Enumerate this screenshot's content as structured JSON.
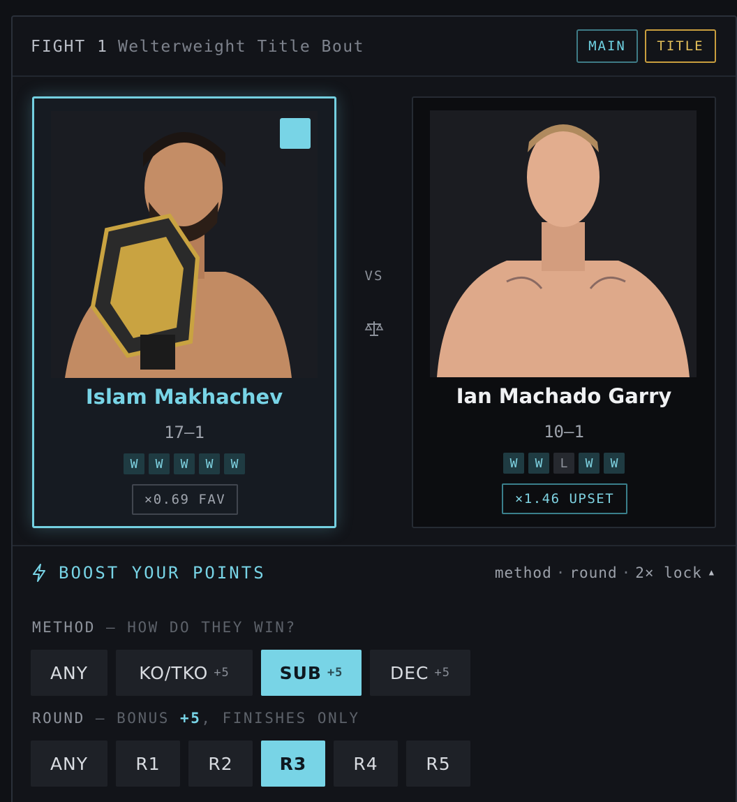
{
  "fight": {
    "label": "FIGHT 1",
    "subtitle": "Welterweight Title Bout",
    "tags": [
      "MAIN",
      "TITLE"
    ]
  },
  "fighters": [
    {
      "name": "Islam Makhachev",
      "record": "17–1",
      "streak": [
        "W",
        "W",
        "W",
        "W",
        "W"
      ],
      "odds": "×0.69 FAV",
      "selected": true
    },
    {
      "name": "Ian Machado Garry",
      "record": "10–1",
      "streak": [
        "W",
        "W",
        "L",
        "W",
        "W"
      ],
      "odds": "×1.46 UPSET",
      "selected": false
    }
  ],
  "versus": "VS",
  "boost": {
    "title": "BOOST YOUR POINTS",
    "meta": [
      "method",
      "round",
      "2× lock"
    ]
  },
  "method": {
    "label": "METHOD",
    "question": "— HOW DO THEY WIN?",
    "options": [
      {
        "label": "ANY",
        "bonus": ""
      },
      {
        "label": "KO/TKO",
        "bonus": "+5"
      },
      {
        "label": "SUB",
        "bonus": "+5"
      },
      {
        "label": "DEC",
        "bonus": "+5"
      }
    ],
    "selected": "SUB"
  },
  "round": {
    "label": "ROUND",
    "bonus_prefix": "— BONUS",
    "bonus_value": "+5",
    "bonus_suffix": ", FINISHES ONLY",
    "options": [
      "ANY",
      "R1",
      "R2",
      "R3",
      "R4",
      "R5"
    ],
    "selected": "R3"
  },
  "colors": {
    "accent": "#78d4e6",
    "gold": "#e5c15a",
    "background": "#121419"
  }
}
